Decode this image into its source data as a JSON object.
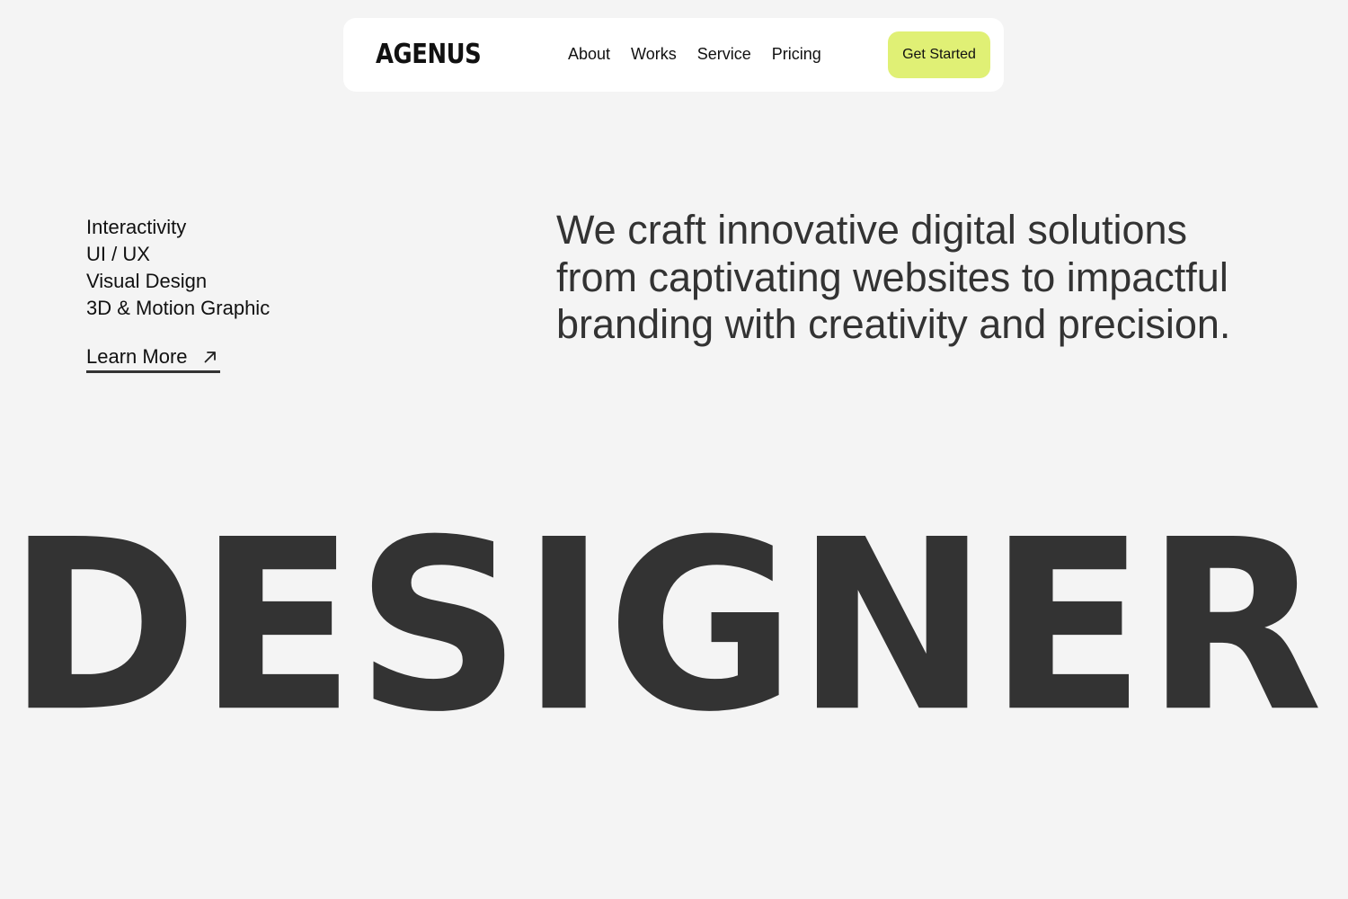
{
  "header": {
    "logo": "AGENUS",
    "nav": [
      {
        "label": "About"
      },
      {
        "label": "Works"
      },
      {
        "label": "Service"
      },
      {
        "label": "Pricing"
      }
    ],
    "cta_label": "Get Started"
  },
  "hero": {
    "services": [
      "Interactivity",
      "UI / UX",
      "Visual Design",
      "3D & Motion Graphic"
    ],
    "learn_more_label": "Learn More",
    "tagline": "We craft innovative digital solutions from captivating websites to impactful branding with creativity and precision.",
    "big_word": "DESIGNER"
  },
  "icons": {
    "learn_more": "arrow-up-right-icon"
  },
  "colors": {
    "background": "#f4f4f4",
    "nav_background": "#ffffff",
    "accent": "#e0f075",
    "text_dark": "#333333",
    "text": "#111111"
  }
}
